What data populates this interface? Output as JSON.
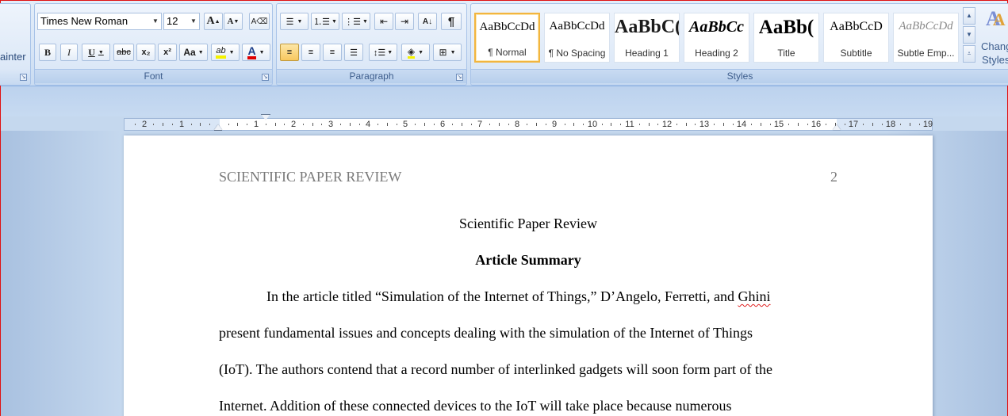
{
  "clipboard": {
    "format_painter_fragment": "ainter"
  },
  "font": {
    "group_label": "Font",
    "font_name": "Times New Roman",
    "font_size": "12",
    "buttons": {
      "bold": "B",
      "italic": "I",
      "underline": "U",
      "strike": "abc",
      "subscript": "x₂",
      "superscript": "x²",
      "change_case": "Aa",
      "highlight": "ab",
      "font_color": "A",
      "grow": "A",
      "shrink": "A"
    }
  },
  "paragraph": {
    "group_label": "Paragraph",
    "show_marks": "¶"
  },
  "styles": {
    "group_label": "Styles",
    "gallery": [
      {
        "sample": "AaBbCcDd",
        "name": "¶ Normal",
        "selected": true
      },
      {
        "sample": "AaBbCcDd",
        "name": "¶ No Spacing",
        "selected": false
      },
      {
        "sample": "AaBbC(",
        "name": "Heading 1",
        "selected": false
      },
      {
        "sample": "AaBbCc",
        "name": "Heading 2",
        "selected": false
      },
      {
        "sample": "AaBb(",
        "name": "Title",
        "selected": false
      },
      {
        "sample": "AaBbCcD",
        "name": "Subtitle",
        "selected": false
      },
      {
        "sample": "AaBbCcDd",
        "name": "Subtle Emp...",
        "selected": false
      }
    ],
    "change_styles_label_1": "Chang",
    "change_styles_label_2": "Styles"
  },
  "ruler": {
    "left_numbers": [
      "2",
      "1"
    ],
    "right_numbers": [
      "1",
      "2",
      "3",
      "4",
      "5",
      "6",
      "7",
      "8",
      "9",
      "10",
      "11",
      "12",
      "13",
      "14",
      "15",
      "16",
      "17",
      "18",
      "19"
    ]
  },
  "document": {
    "header_left": "SCIENTIFIC PAPER REVIEW",
    "page_number": "2",
    "title": "Scientific Paper Review",
    "heading": "Article Summary",
    "line1_main": "In the article titled “Simulation of the Internet of Things,” D’Angelo, Ferretti, and ",
    "line1_misspelled": "Ghini",
    "line2": "present fundamental issues and concepts dealing with the simulation of the Internet of Things",
    "line3": "(IoT). The authors contend that a record number of interlinked gadgets will soon form part of the",
    "line4": "Internet. Addition of these connected devices to the IoT will take place because numerous"
  }
}
